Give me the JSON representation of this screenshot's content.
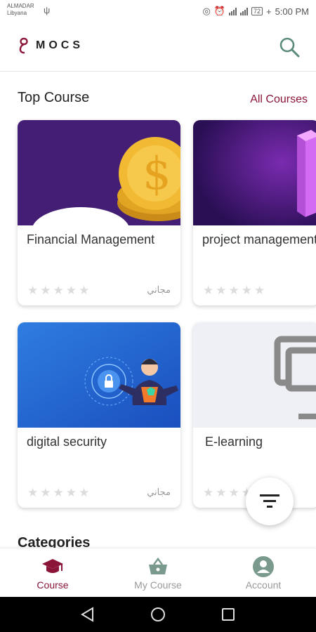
{
  "status_bar": {
    "carrier_line1": "ALMADAR",
    "carrier_line2": "Libyana",
    "usb_icon": "usb-icon",
    "net1": "4G",
    "net2": "4G",
    "battery": "72",
    "charging": "+",
    "time": "5:00 PM"
  },
  "header": {
    "logo_text": "MOCS",
    "search_icon": "search-icon"
  },
  "top_course": {
    "title": "Top Course",
    "all_courses_label": "All Courses"
  },
  "courses": [
    {
      "title": "Financial Management",
      "price": "مجاني",
      "rating": 0
    },
    {
      "title": "project management",
      "price": "",
      "rating": 0
    },
    {
      "title": "digital security",
      "price": "مجاني",
      "rating": 0
    },
    {
      "title": "E-learning",
      "price": "",
      "rating": 0
    }
  ],
  "categories_title": "Categories",
  "bottom_nav": {
    "items": [
      {
        "label": "Course",
        "icon": "graduation-cap-icon",
        "active": true
      },
      {
        "label": "My Course",
        "icon": "basket-icon",
        "active": false
      },
      {
        "label": "Account",
        "icon": "account-icon",
        "active": false
      }
    ]
  },
  "colors": {
    "accent": "#8a1538",
    "inactive": "#9e9e9e"
  }
}
